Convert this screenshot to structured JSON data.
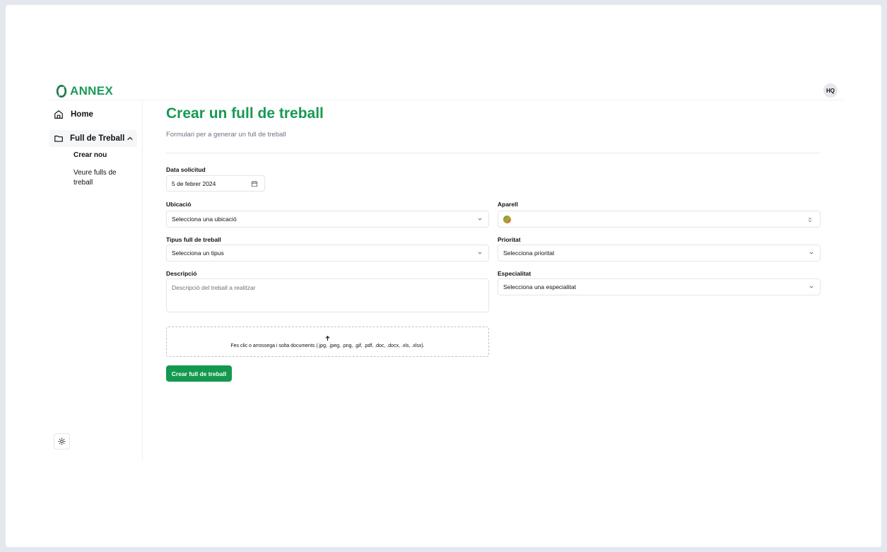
{
  "header": {
    "logo_text": "ANNEX",
    "avatar_initials": "HQ",
    "brand_color": "#1a9a5a"
  },
  "sidebar": {
    "home_label": "Home",
    "section_label": "Full de Treball",
    "sub_items": [
      {
        "label": "Crear nou"
      },
      {
        "label": "Veure fulls de treball"
      }
    ]
  },
  "main": {
    "title": "Crear un full de treball",
    "subtitle": "Formulari per a generar un full de treball",
    "form": {
      "date_label": "Data solicitud",
      "date_value": "5 de febrer 2024",
      "location_label": "Ubicació",
      "location_value": "Selecciona una ubicació",
      "device_label": "Aparell",
      "device_value": "",
      "type_label": "Tipus full de treball",
      "type_value": "Selecciona un tipus",
      "priority_label": "Prioritat",
      "priority_value": "Selecciona prioritat",
      "description_label": "Descripció",
      "description_placeholder": "Descripció del treball a realitzar",
      "specialty_label": "Especialitat",
      "specialty_value": "Selecciona una especialitat",
      "dropzone_text": "Fes clic o arrossega i solta documents (.jpg, .jpeg, .png, .gif, .pdf, .doc, .docx, .xls, .xlsx).",
      "submit_label": "Crear full de treball"
    }
  },
  "colors": {
    "accent": "#13994f",
    "title": "#179a52"
  }
}
